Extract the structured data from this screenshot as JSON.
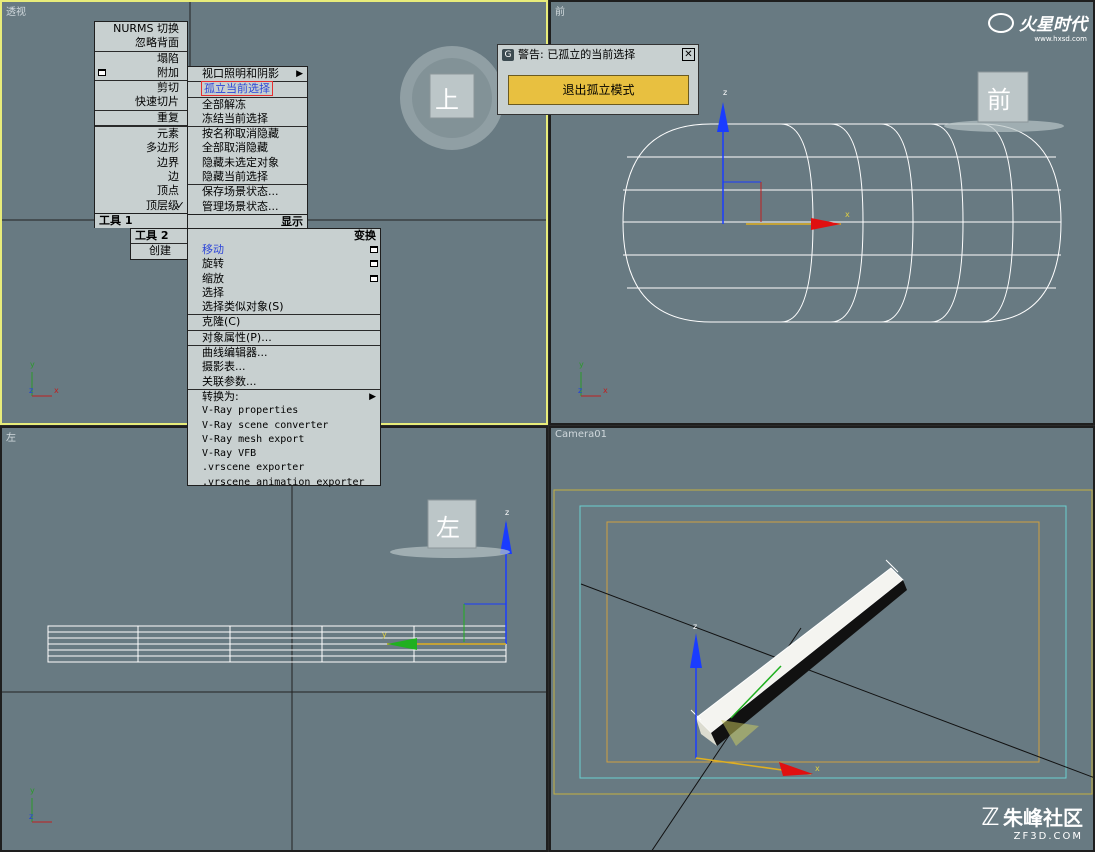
{
  "viewports": {
    "perspective": {
      "label": "透视"
    },
    "front": {
      "label": "前"
    },
    "left": {
      "label": "左"
    },
    "camera": {
      "label": "Camera01"
    }
  },
  "viewcube": {
    "top": "上",
    "front": "前",
    "left": "左"
  },
  "axis": {
    "x": "x",
    "y": "y",
    "z": "z"
  },
  "quad_left_top": {
    "items": [
      "NURMS 切换",
      "忽略背面",
      "塌陷",
      "附加",
      "剪切",
      "快速切片",
      "重复",
      "元素",
      "多边形",
      "边界",
      "边",
      "顶点",
      "顶层级"
    ],
    "title": "工具 1"
  },
  "quad_right_top": {
    "items": [
      "视口照明和阴影",
      "孤立当前选择",
      "全部解冻",
      "冻结当前选择",
      "按名称取消隐藏",
      "全部取消隐藏",
      "隐藏未选定对象",
      "隐藏当前选择",
      "保存场景状态...",
      "管理场景状态..."
    ],
    "title": "显示"
  },
  "quad_left_bottom": {
    "title": "工具 2",
    "items": [
      "创建"
    ]
  },
  "quad_right_bottom": {
    "title": "变换",
    "items": [
      "移动",
      "旋转",
      "缩放",
      "选择",
      "选择类似对象(S)",
      "克隆(C)",
      "对象属性(P)...",
      "曲线编辑器...",
      "摄影表...",
      "关联参数...",
      "转换为:",
      "V-Ray properties",
      "V-Ray scene converter",
      "V-Ray mesh export",
      "V-Ray VFB",
      ".vrscene exporter",
      ".vrscene animation exporter"
    ]
  },
  "dialog": {
    "icon": "G",
    "title": "警告: 已孤立的当前选择",
    "close": "✕",
    "button": "退出孤立模式"
  },
  "watermarks": {
    "top_right": "火星时代",
    "top_right_url": "www.hxsd.com",
    "bottom_right": "朱峰社区",
    "bottom_right_url": "ZF3D.COM"
  },
  "colors": {
    "viewport_bg": "#687a82",
    "active_border": "#e8ec7a",
    "menu_bg": "#c8d0d0",
    "highlight_text": "#2e46d8",
    "dialog_button": "#e8c040",
    "axis_x": "#d02020",
    "axis_y": "#20b020",
    "axis_z": "#2040e0"
  }
}
